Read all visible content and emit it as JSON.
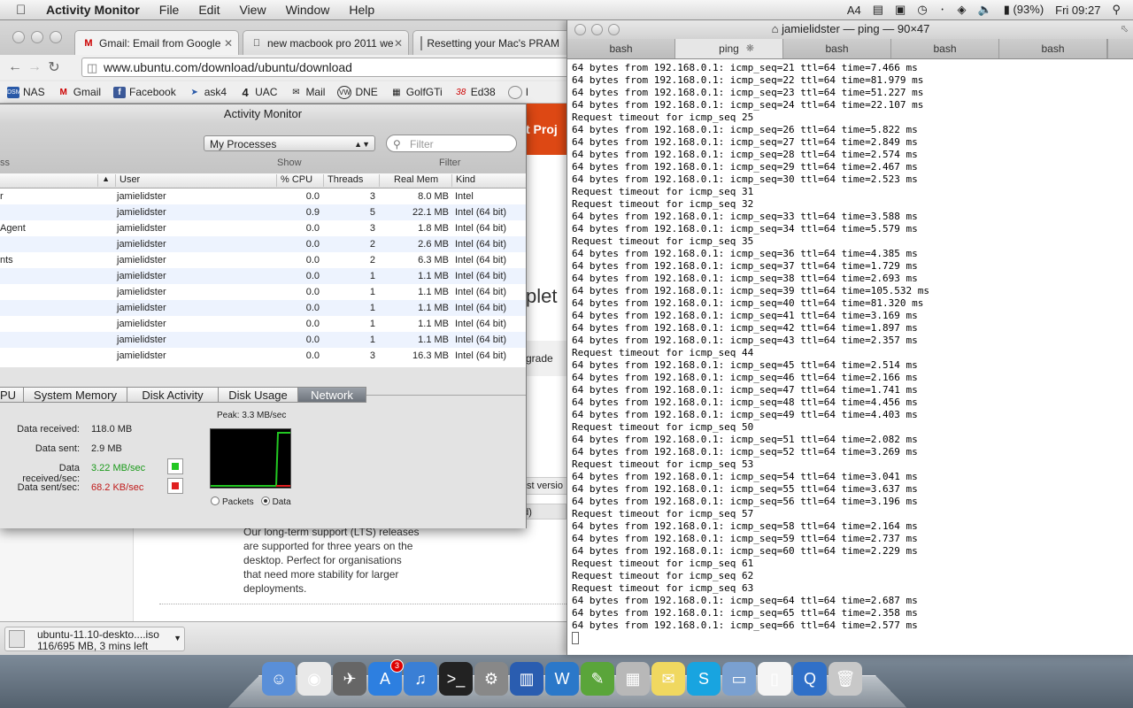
{
  "menubar": {
    "app_name": "Activity Monitor",
    "items": [
      "File",
      "Edit",
      "View",
      "Window",
      "Help"
    ],
    "input_num": "4",
    "battery": "(93%)",
    "clock": "Fri 09:27"
  },
  "chrome": {
    "tabs": [
      {
        "label": "Gmail: Email from Google"
      },
      {
        "label": "new macbook pro 2011 we"
      },
      {
        "label": "Resetting your Mac's PRAM"
      }
    ],
    "url": "www.ubuntu.com/download/ubuntu/download",
    "bookmarks": [
      {
        "label": "NAS"
      },
      {
        "label": "Gmail"
      },
      {
        "label": "Facebook"
      },
      {
        "label": "ask4"
      },
      {
        "label": "UAC"
      },
      {
        "label": "Mail"
      },
      {
        "label": "DNE"
      },
      {
        "label": "GolfGTi"
      },
      {
        "label": "Ed38"
      },
      {
        "label": "I"
      }
    ],
    "page": {
      "nav_fragment": "t  Proj",
      "heading_fragment": "plet",
      "upgrade_fragment": "grade",
      "version_fragment": "st versio",
      "ed_fragment": "ed)",
      "lts_text": "Our long-term support (LTS) releases are supported for three years on the desktop. Perfect for organisations that need more stability for larger deployments."
    },
    "download": {
      "name": "ubuntu-11.10-deskto....iso",
      "status": "116/695 MB, 3 mins left"
    }
  },
  "activity_monitor": {
    "title": "Activity Monitor",
    "process_filter": "My Processes",
    "filter_placeholder": "Filter",
    "labels": {
      "show": "Show",
      "filter": "Filter",
      "ss": "ss"
    },
    "columns": {
      "user": "User",
      "cpu": "% CPU",
      "threads": "Threads",
      "mem": "Real Mem",
      "kind": "Kind"
    },
    "rows": [
      {
        "proc": "r",
        "user": "jamielidster",
        "cpu": "0.0",
        "threads": "3",
        "mem": "8.0 MB",
        "kind": "Intel"
      },
      {
        "proc": "",
        "user": "jamielidster",
        "cpu": "0.9",
        "threads": "5",
        "mem": "22.1 MB",
        "kind": "Intel (64 bit)"
      },
      {
        "proc": "Agent",
        "user": "jamielidster",
        "cpu": "0.0",
        "threads": "3",
        "mem": "1.8 MB",
        "kind": "Intel (64 bit)"
      },
      {
        "proc": "",
        "user": "jamielidster",
        "cpu": "0.0",
        "threads": "2",
        "mem": "2.6 MB",
        "kind": "Intel (64 bit)"
      },
      {
        "proc": "nts",
        "user": "jamielidster",
        "cpu": "0.0",
        "threads": "2",
        "mem": "6.3 MB",
        "kind": "Intel (64 bit)"
      },
      {
        "proc": "",
        "user": "jamielidster",
        "cpu": "0.0",
        "threads": "1",
        "mem": "1.1 MB",
        "kind": "Intel (64 bit)"
      },
      {
        "proc": "",
        "user": "jamielidster",
        "cpu": "0.0",
        "threads": "1",
        "mem": "1.1 MB",
        "kind": "Intel (64 bit)"
      },
      {
        "proc": "",
        "user": "jamielidster",
        "cpu": "0.0",
        "threads": "1",
        "mem": "1.1 MB",
        "kind": "Intel (64 bit)"
      },
      {
        "proc": "",
        "user": "jamielidster",
        "cpu": "0.0",
        "threads": "1",
        "mem": "1.1 MB",
        "kind": "Intel (64 bit)"
      },
      {
        "proc": "",
        "user": "jamielidster",
        "cpu": "0.0",
        "threads": "1",
        "mem": "1.1 MB",
        "kind": "Intel (64 bit)"
      },
      {
        "proc": "",
        "user": "jamielidster",
        "cpu": "0.0",
        "threads": "3",
        "mem": "16.3 MB",
        "kind": "Intel (64 bit)"
      }
    ],
    "tabs": [
      "PU",
      "System Memory",
      "Disk Activity",
      "Disk Usage",
      "Network"
    ],
    "network": {
      "data_received_label": "Data received:",
      "data_received": "118.0 MB",
      "data_sent_label": "Data sent:",
      "data_sent": "2.9 MB",
      "rx_rate_label": "Data received/sec:",
      "rx_rate": "3.22 MB/sec",
      "tx_rate_label": "Data sent/sec:",
      "tx_rate": "68.2 KB/sec",
      "peak": "Peak: 3.3 MB/sec",
      "radio_packets": "Packets",
      "radio_data": "Data",
      "rx_color": "#22c722",
      "tx_color": "#e02020"
    }
  },
  "terminal": {
    "title": "jamielidster — ping — 90×47",
    "tabs": [
      "bash",
      "ping",
      "bash",
      "bash",
      "bash"
    ],
    "lines": [
      "64 bytes from 192.168.0.1: icmp_seq=21 ttl=64 time=7.466 ms",
      "64 bytes from 192.168.0.1: icmp_seq=22 ttl=64 time=81.979 ms",
      "64 bytes from 192.168.0.1: icmp_seq=23 ttl=64 time=51.227 ms",
      "64 bytes from 192.168.0.1: icmp_seq=24 ttl=64 time=22.107 ms",
      "Request timeout for icmp_seq 25",
      "64 bytes from 192.168.0.1: icmp_seq=26 ttl=64 time=5.822 ms",
      "64 bytes from 192.168.0.1: icmp_seq=27 ttl=64 time=2.849 ms",
      "64 bytes from 192.168.0.1: icmp_seq=28 ttl=64 time=2.574 ms",
      "64 bytes from 192.168.0.1: icmp_seq=29 ttl=64 time=2.467 ms",
      "64 bytes from 192.168.0.1: icmp_seq=30 ttl=64 time=2.523 ms",
      "Request timeout for icmp_seq 31",
      "Request timeout for icmp_seq 32",
      "64 bytes from 192.168.0.1: icmp_seq=33 ttl=64 time=3.588 ms",
      "64 bytes from 192.168.0.1: icmp_seq=34 ttl=64 time=5.579 ms",
      "Request timeout for icmp_seq 35",
      "64 bytes from 192.168.0.1: icmp_seq=36 ttl=64 time=4.385 ms",
      "64 bytes from 192.168.0.1: icmp_seq=37 ttl=64 time=1.729 ms",
      "64 bytes from 192.168.0.1: icmp_seq=38 ttl=64 time=2.693 ms",
      "64 bytes from 192.168.0.1: icmp_seq=39 ttl=64 time=105.532 ms",
      "64 bytes from 192.168.0.1: icmp_seq=40 ttl=64 time=81.320 ms",
      "64 bytes from 192.168.0.1: icmp_seq=41 ttl=64 time=3.169 ms",
      "64 bytes from 192.168.0.1: icmp_seq=42 ttl=64 time=1.897 ms",
      "64 bytes from 192.168.0.1: icmp_seq=43 ttl=64 time=2.357 ms",
      "Request timeout for icmp_seq 44",
      "64 bytes from 192.168.0.1: icmp_seq=45 ttl=64 time=2.514 ms",
      "64 bytes from 192.168.0.1: icmp_seq=46 ttl=64 time=2.166 ms",
      "64 bytes from 192.168.0.1: icmp_seq=47 ttl=64 time=1.741 ms",
      "64 bytes from 192.168.0.1: icmp_seq=48 ttl=64 time=4.456 ms",
      "64 bytes from 192.168.0.1: icmp_seq=49 ttl=64 time=4.403 ms",
      "Request timeout for icmp_seq 50",
      "64 bytes from 192.168.0.1: icmp_seq=51 ttl=64 time=2.082 ms",
      "64 bytes from 192.168.0.1: icmp_seq=52 ttl=64 time=3.269 ms",
      "Request timeout for icmp_seq 53",
      "64 bytes from 192.168.0.1: icmp_seq=54 ttl=64 time=3.041 ms",
      "64 bytes from 192.168.0.1: icmp_seq=55 ttl=64 time=3.637 ms",
      "64 bytes from 192.168.0.1: icmp_seq=56 ttl=64 time=3.196 ms",
      "Request timeout for icmp_seq 57",
      "64 bytes from 192.168.0.1: icmp_seq=58 ttl=64 time=2.164 ms",
      "64 bytes from 192.168.0.1: icmp_seq=59 ttl=64 time=2.737 ms",
      "64 bytes from 192.168.0.1: icmp_seq=60 ttl=64 time=2.229 ms",
      "Request timeout for icmp_seq 61",
      "Request timeout for icmp_seq 62",
      "Request timeout for icmp_seq 63",
      "64 bytes from 192.168.0.1: icmp_seq=64 ttl=64 time=2.687 ms",
      "64 bytes from 192.168.0.1: icmp_seq=65 ttl=64 time=2.358 ms",
      "64 bytes from 192.168.0.1: icmp_seq=66 ttl=64 time=2.577 ms"
    ]
  },
  "dock": {
    "items": [
      {
        "icon": "finder-icon"
      },
      {
        "icon": "chrome-icon"
      },
      {
        "icon": "launchpad-icon"
      },
      {
        "icon": "app-store-icon",
        "badge": "3"
      },
      {
        "icon": "itunes-icon"
      },
      {
        "icon": "terminal-icon"
      },
      {
        "icon": "system-preferences-icon"
      },
      {
        "icon": "activity-monitor-icon"
      },
      {
        "icon": "word-icon"
      },
      {
        "icon": "evernote-icon"
      },
      {
        "icon": "calculator-icon"
      },
      {
        "icon": "stickies-icon"
      },
      {
        "icon": "skype-icon"
      },
      {
        "icon": "folder-icon"
      },
      {
        "icon": "document-icon"
      },
      {
        "icon": "quicktime-icon"
      },
      {
        "icon": "trash-icon"
      }
    ]
  }
}
